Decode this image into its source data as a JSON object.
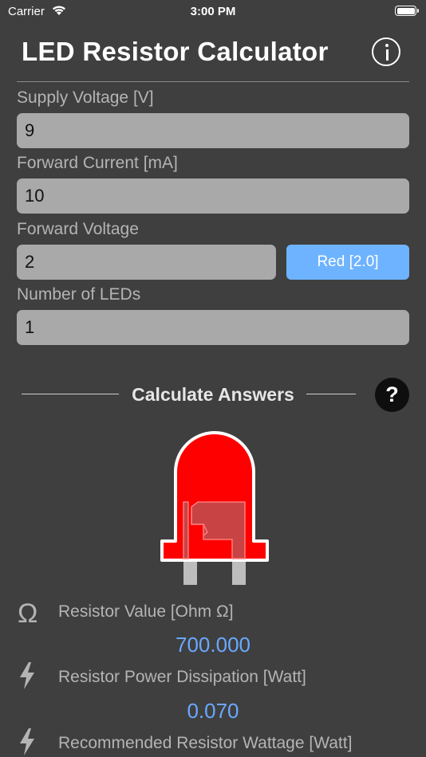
{
  "status_bar": {
    "carrier": "Carrier",
    "time": "3:00 PM"
  },
  "header": {
    "title": "LED Resistor Calculator"
  },
  "inputs": {
    "supply_voltage": {
      "label": "Supply Voltage [V]",
      "value": "9"
    },
    "forward_current": {
      "label": "Forward Current [mA]",
      "value": "10"
    },
    "forward_voltage": {
      "label": "Forward Voltage",
      "value": "2",
      "preset_button": "Red [2.0]"
    },
    "num_leds": {
      "label": "Number of LEDs",
      "value": "1"
    }
  },
  "calculate": {
    "label": "Calculate Answers",
    "help": "?"
  },
  "led_color": "#ff0000",
  "results": {
    "resistor_value": {
      "label": "Resistor Value [Ohm Ω]",
      "value": "700.000",
      "icon": "Ω"
    },
    "power_dissipation": {
      "label": "Resistor Power Dissipation [Watt]",
      "value": "0.070"
    },
    "recommended_wattage": {
      "label": "Recommended Resistor Wattage [Watt]"
    }
  }
}
